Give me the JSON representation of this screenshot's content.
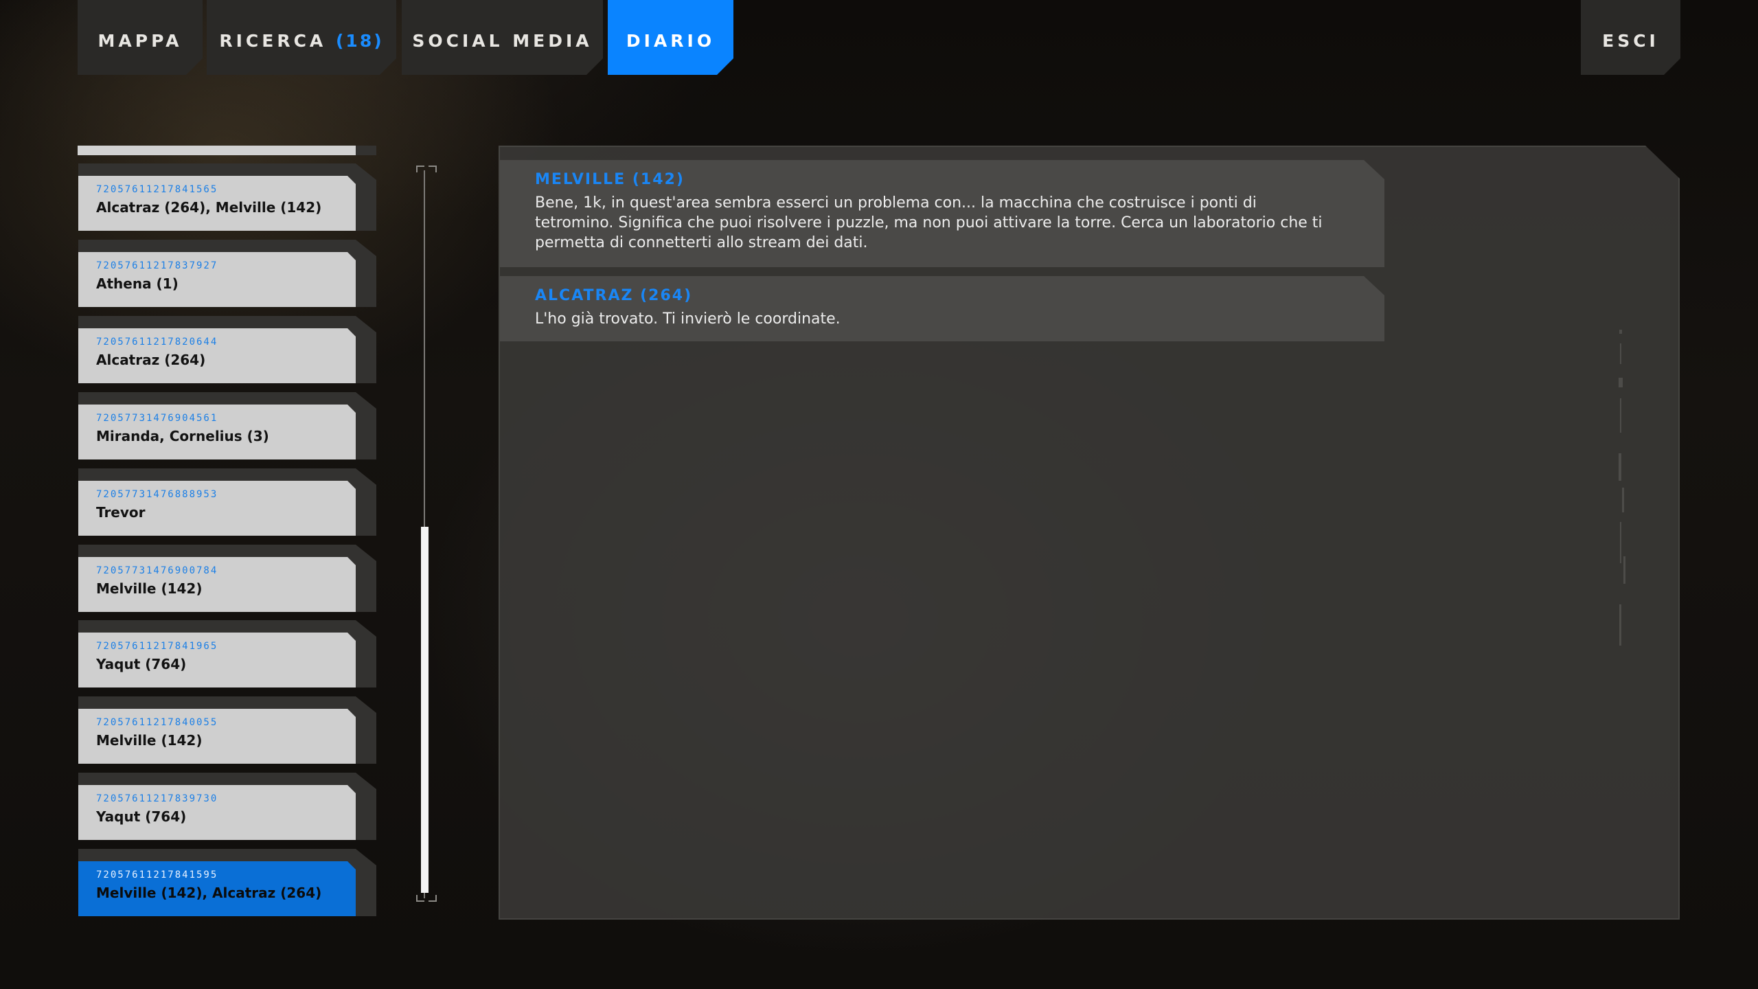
{
  "tabs": [
    {
      "label": "MAPPA"
    },
    {
      "label": "RICERCA",
      "count": "(18)"
    },
    {
      "label": "SOCIAL MEDIA"
    },
    {
      "label": "DIARIO",
      "active": true
    }
  ],
  "exit": {
    "label": "ESCI"
  },
  "entries": [
    {
      "id": "72057611217841565",
      "names": "Alcatraz (264), Melville (142)"
    },
    {
      "id": "72057611217837927",
      "names": "Athena (1)"
    },
    {
      "id": "72057611217820644",
      "names": "Alcatraz (264)"
    },
    {
      "id": "72057731476904561",
      "names": "Miranda, Cornelius (3)"
    },
    {
      "id": "72057731476888953",
      "names": "Trevor"
    },
    {
      "id": "72057731476900784",
      "names": "Melville (142)"
    },
    {
      "id": "72057611217841965",
      "names": "Yaqut (764)"
    },
    {
      "id": "72057611217840055",
      "names": "Melville (142)"
    },
    {
      "id": "72057611217839730",
      "names": "Yaqut (764)"
    },
    {
      "id": "72057611217841595",
      "names": "Melville (142), Alcatraz (264)",
      "selected": true
    }
  ],
  "messages": [
    {
      "author": "MELVILLE (142)",
      "text": "Bene, 1k, in quest'area sembra esserci un problema con... la macchina che costruisce i ponti di tetromino. Significa che puoi risolvere i puzzle, ma non puoi attivare la torre. Cerca un laboratorio che ti permetta di connetterti allo stream dei dati."
    },
    {
      "author": "ALCATRAZ (264)",
      "text": "L'ho già trovato. Ti invierò le coordinate."
    }
  ],
  "colors": {
    "accent": "#0a84ff",
    "author_text": "#1a86f5",
    "card": "#cfcfcf",
    "selected_card": "#0a6fd6"
  }
}
